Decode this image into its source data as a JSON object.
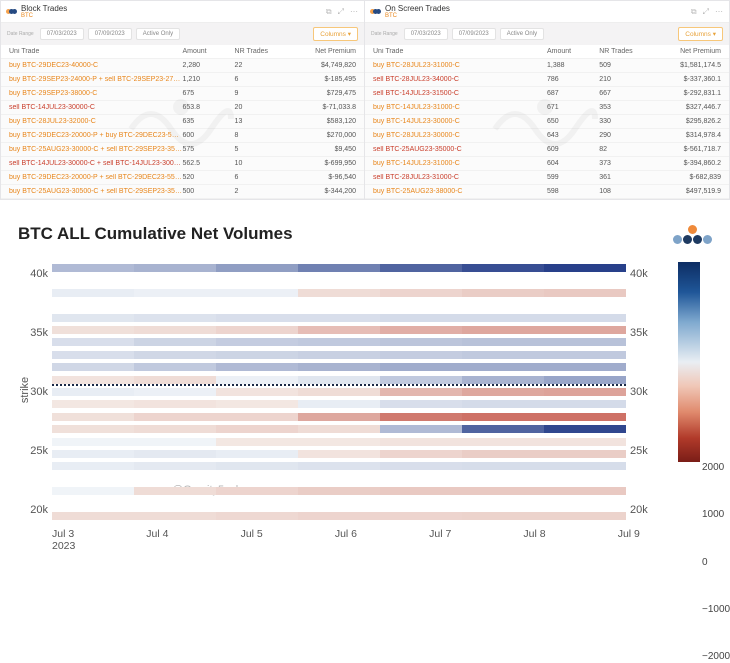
{
  "panel_left": {
    "title": "Block Trades",
    "subtitle": "BTC",
    "date_range_label": "Date Range",
    "date1": "07/03/2023",
    "date2": "07/09/2023",
    "active_only": "Active Only",
    "columns_btn": "Columns",
    "headers": {
      "c1": "Uni Trade",
      "c2": "Amount",
      "c3": "NR Trades",
      "c4": "Net Premium"
    },
    "rows": [
      {
        "side": "buy",
        "trade": "buy BTC-29DEC23-40000-C",
        "amount": "2,280",
        "nr": "22",
        "np": "$4,749,820"
      },
      {
        "side": "buy",
        "trade": "buy BTC-29SEP23-24000-P + sell BTC-29SEP23-27000-P",
        "amount": "1,210",
        "nr": "6",
        "np": "$-185,495"
      },
      {
        "side": "buy",
        "trade": "buy BTC-29SEP23-38000-C",
        "amount": "675",
        "nr": "9",
        "np": "$729,475"
      },
      {
        "side": "sell",
        "trade": "sell BTC-14JUL23-30000-C",
        "amount": "653.8",
        "nr": "20",
        "np": "$-71,033.8"
      },
      {
        "side": "buy",
        "trade": "buy BTC-28JUL23-32000-C",
        "amount": "635",
        "nr": "13",
        "np": "$583,120"
      },
      {
        "side": "buy",
        "trade": "buy BTC-29DEC23-20000-P + buy BTC-29DEC23-50000-C",
        "amount": "600",
        "nr": "8",
        "np": "$270,000"
      },
      {
        "side": "buy",
        "trade": "buy BTC-25AUG23-30000-C + sell BTC-29SEP23-35000-C",
        "amount": "575",
        "nr": "5",
        "np": "$9,450"
      },
      {
        "side": "sell",
        "trade": "sell BTC-14JUL23-30000-C + sell BTC-14JUL23-30000-P",
        "amount": "562.5",
        "nr": "10",
        "np": "$-699,950"
      },
      {
        "side": "buy",
        "trade": "buy BTC-29DEC23-20000-P + sell BTC-29DEC23-55000-C",
        "amount": "520",
        "nr": "6",
        "np": "$-96,540"
      },
      {
        "side": "buy",
        "trade": "buy BTC-25AUG23-30500-C + sell BTC-29SEP23-35000-C",
        "amount": "500",
        "nr": "2",
        "np": "$-344,200"
      }
    ]
  },
  "panel_right": {
    "title": "On Screen Trades",
    "subtitle": "BTC",
    "date_range_label": "Date Range",
    "date1": "07/03/2023",
    "date2": "07/09/2023",
    "active_only": "Active Only",
    "columns_btn": "Columns",
    "headers": {
      "c1": "Uni Trade",
      "c2": "Amount",
      "c3": "NR Trades",
      "c4": "Net Premium"
    },
    "rows": [
      {
        "side": "buy",
        "trade": "buy BTC-28JUL23-31000-C",
        "amount": "1,388",
        "nr": "509",
        "np": "$1,581,174.5"
      },
      {
        "side": "sell",
        "trade": "sell BTC-28JUL23-34000-C",
        "amount": "786",
        "nr": "210",
        "np": "$-337,360.1"
      },
      {
        "side": "sell",
        "trade": "sell BTC-14JUL23-31500-C",
        "amount": "687",
        "nr": "667",
        "np": "$-292,831.1"
      },
      {
        "side": "buy",
        "trade": "buy BTC-14JUL23-31000-C",
        "amount": "671",
        "nr": "353",
        "np": "$327,446.7"
      },
      {
        "side": "buy",
        "trade": "buy BTC-14JUL23-30000-C",
        "amount": "650",
        "nr": "330",
        "np": "$295,826.2"
      },
      {
        "side": "buy",
        "trade": "buy BTC-28JUL23-30000-C",
        "amount": "643",
        "nr": "290",
        "np": "$314,978.4"
      },
      {
        "side": "sell",
        "trade": "sell BTC-25AUG23-35000-C",
        "amount": "609",
        "nr": "82",
        "np": "$-561,718.7"
      },
      {
        "side": "buy",
        "trade": "buy BTC-14JUL23-31000-C",
        "amount": "604",
        "nr": "373",
        "np": "$-394,860.2"
      },
      {
        "side": "sell",
        "trade": "sell BTC-28JUL23-31000-C",
        "amount": "599",
        "nr": "361",
        "np": "$-682,839"
      },
      {
        "side": "buy",
        "trade": "buy BTC-25AUG23-38000-C",
        "amount": "598",
        "nr": "108",
        "np": "$497,519.9"
      }
    ]
  },
  "chart": {
    "title": "BTC ALL Cumulative Net Volumes",
    "ylabel": "strike",
    "watermark": "@Gravity5ucks",
    "yticks": [
      "40k",
      "35k",
      "30k",
      "25k",
      "20k"
    ],
    "yticks_r": [
      "40k",
      "35k",
      "30k",
      "25k",
      "20k"
    ],
    "xticks": [
      "Jul 3",
      "Jul 4",
      "Jul 5",
      "Jul 6",
      "Jul 7",
      "Jul 8",
      "Jul 9"
    ],
    "xyear": "2023",
    "cbar_ticks": [
      "2000",
      "1000",
      "0",
      "−1000",
      "−2000"
    ]
  },
  "chart_data": {
    "type": "heatmap",
    "title": "BTC ALL Cumulative Net Volumes",
    "xlabel": "date",
    "ylabel": "strike",
    "x": [
      "2023-07-03",
      "2023-07-04",
      "2023-07-05",
      "2023-07-06",
      "2023-07-07",
      "2023-07-08",
      "2023-07-09"
    ],
    "y_strikes_k": [
      40,
      38,
      36,
      35,
      34,
      33,
      32,
      31,
      30,
      29,
      28,
      27,
      26,
      25,
      24,
      22,
      20
    ],
    "colorbar": {
      "min": -2500,
      "max": 2500,
      "ticks": [
        2000,
        1000,
        0,
        -1000,
        -2000
      ]
    },
    "z": [
      [
        800,
        900,
        1200,
        1600,
        2000,
        2300,
        2500
      ],
      [
        100,
        50,
        50,
        -200,
        -300,
        -400,
        -450
      ],
      [
        200,
        250,
        300,
        300,
        350,
        350,
        350
      ],
      [
        -150,
        -200,
        -300,
        -600,
        -800,
        -900,
        -900
      ],
      [
        300,
        450,
        550,
        600,
        650,
        700,
        700
      ],
      [
        300,
        400,
        450,
        500,
        550,
        600,
        600
      ],
      [
        400,
        600,
        800,
        900,
        1000,
        1000,
        1000
      ],
      [
        -100,
        -200,
        50,
        200,
        600,
        900,
        1100
      ],
      [
        100,
        50,
        -100,
        -200,
        -700,
        -900,
        -950
      ],
      [
        -50,
        -100,
        -50,
        100,
        300,
        350,
        350
      ],
      [
        -150,
        -300,
        -300,
        -900,
        -1500,
        -1600,
        -1600
      ],
      [
        -150,
        -200,
        -300,
        -200,
        800,
        2000,
        2400
      ],
      [
        0,
        0,
        -50,
        -50,
        -100,
        -100,
        -100
      ],
      [
        100,
        150,
        100,
        -100,
        -300,
        -400,
        -400
      ],
      [
        100,
        150,
        200,
        250,
        300,
        320,
        320
      ],
      [
        0,
        -200,
        -300,
        -400,
        -450,
        -450,
        -450
      ],
      [
        -200,
        -200,
        -250,
        -300,
        -300,
        -320,
        -320
      ]
    ],
    "price_overlay_approx_k": [
      31.0,
      31.0,
      30.8,
      30.7,
      30.9,
      31.4,
      30.6,
      30.4,
      30.3,
      30.3,
      30.4,
      30.3,
      30.3,
      30.3
    ],
    "watermark": "@Gravity5ucks"
  }
}
